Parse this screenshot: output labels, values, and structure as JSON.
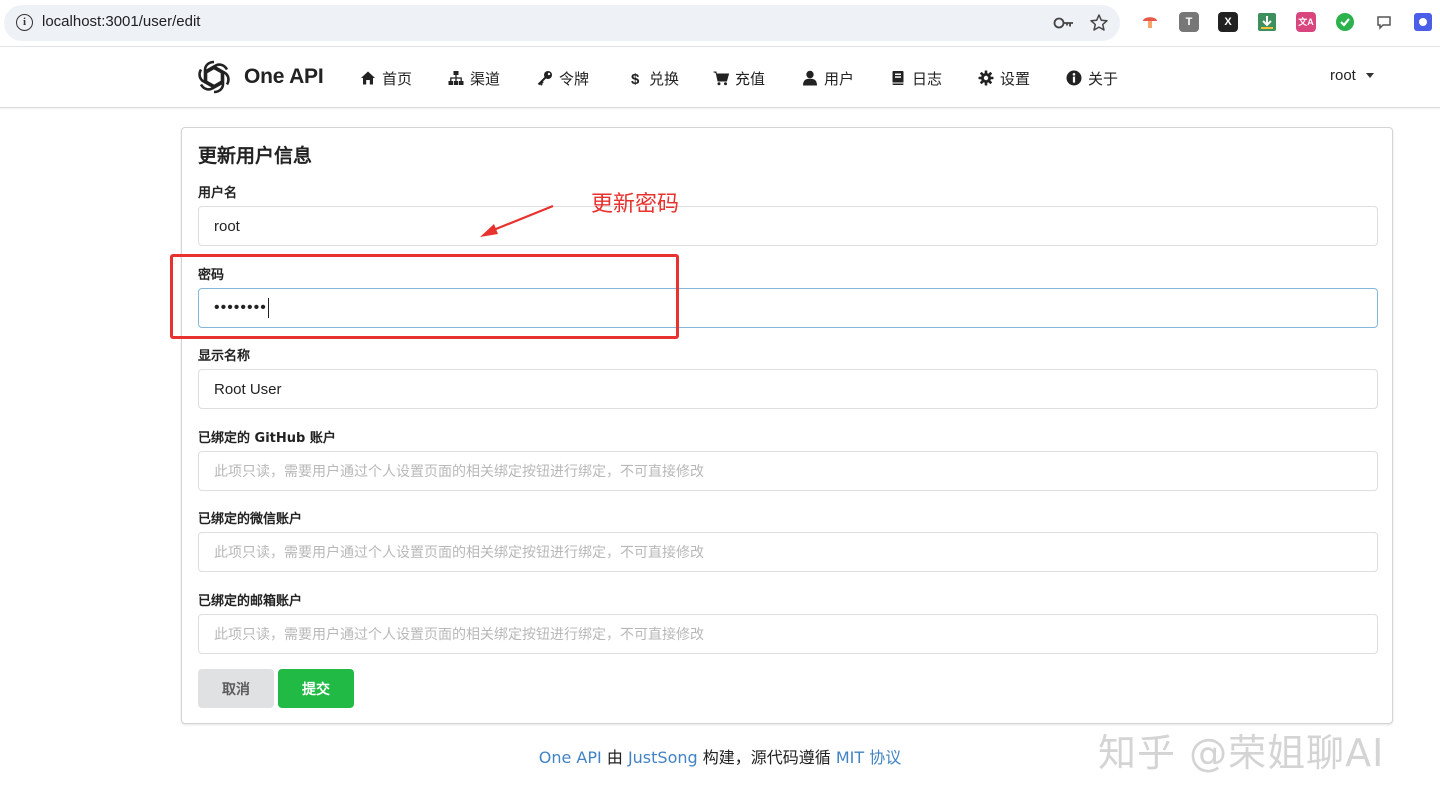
{
  "browser": {
    "url": "localhost:3001/user/edit",
    "extensions": [
      "T",
      "X",
      "文A"
    ]
  },
  "nav": {
    "brand": "One API",
    "items": [
      {
        "label": "首页",
        "icon": "home-icon"
      },
      {
        "label": "渠道",
        "icon": "sitemap-icon"
      },
      {
        "label": "令牌",
        "icon": "key-icon"
      },
      {
        "label": "兑换",
        "icon": "dollar-icon"
      },
      {
        "label": "充值",
        "icon": "cart-icon"
      },
      {
        "label": "用户",
        "icon": "user-icon"
      },
      {
        "label": "日志",
        "icon": "book-icon"
      },
      {
        "label": "设置",
        "icon": "gear-icon"
      },
      {
        "label": "关于",
        "icon": "info-icon"
      }
    ],
    "user": "root"
  },
  "form": {
    "title": "更新用户信息",
    "username_label": "用户名",
    "username_value": "root",
    "password_label": "密码",
    "password_value": "••••••••",
    "display_name_label": "显示名称",
    "display_name_value": "Root User",
    "github_label": "已绑定的 GitHub 账户",
    "github_placeholder": "此项只读，需要用户通过个人设置页面的相关绑定按钮进行绑定，不可直接修改",
    "wechat_label": "已绑定的微信账户",
    "wechat_placeholder": "此项只读，需要用户通过个人设置页面的相关绑定按钮进行绑定，不可直接修改",
    "email_label": "已绑定的邮箱账户",
    "email_placeholder": "此项只读，需要用户通过个人设置页面的相关绑定按钮进行绑定，不可直接修改",
    "cancel_label": "取消",
    "submit_label": "提交"
  },
  "annotation": {
    "text": "更新密码",
    "color": "#e8322f"
  },
  "footer": {
    "brand_link": "One API",
    "by": "由",
    "author_link": "JustSong",
    "built": "构建，源代码遵循",
    "license_link": "MIT 协议"
  },
  "watermark": "知乎 @荣姐聊AI",
  "colors": {
    "submit": "#21ba45",
    "cancel": "#e0e1e2",
    "link": "#4183c4"
  }
}
